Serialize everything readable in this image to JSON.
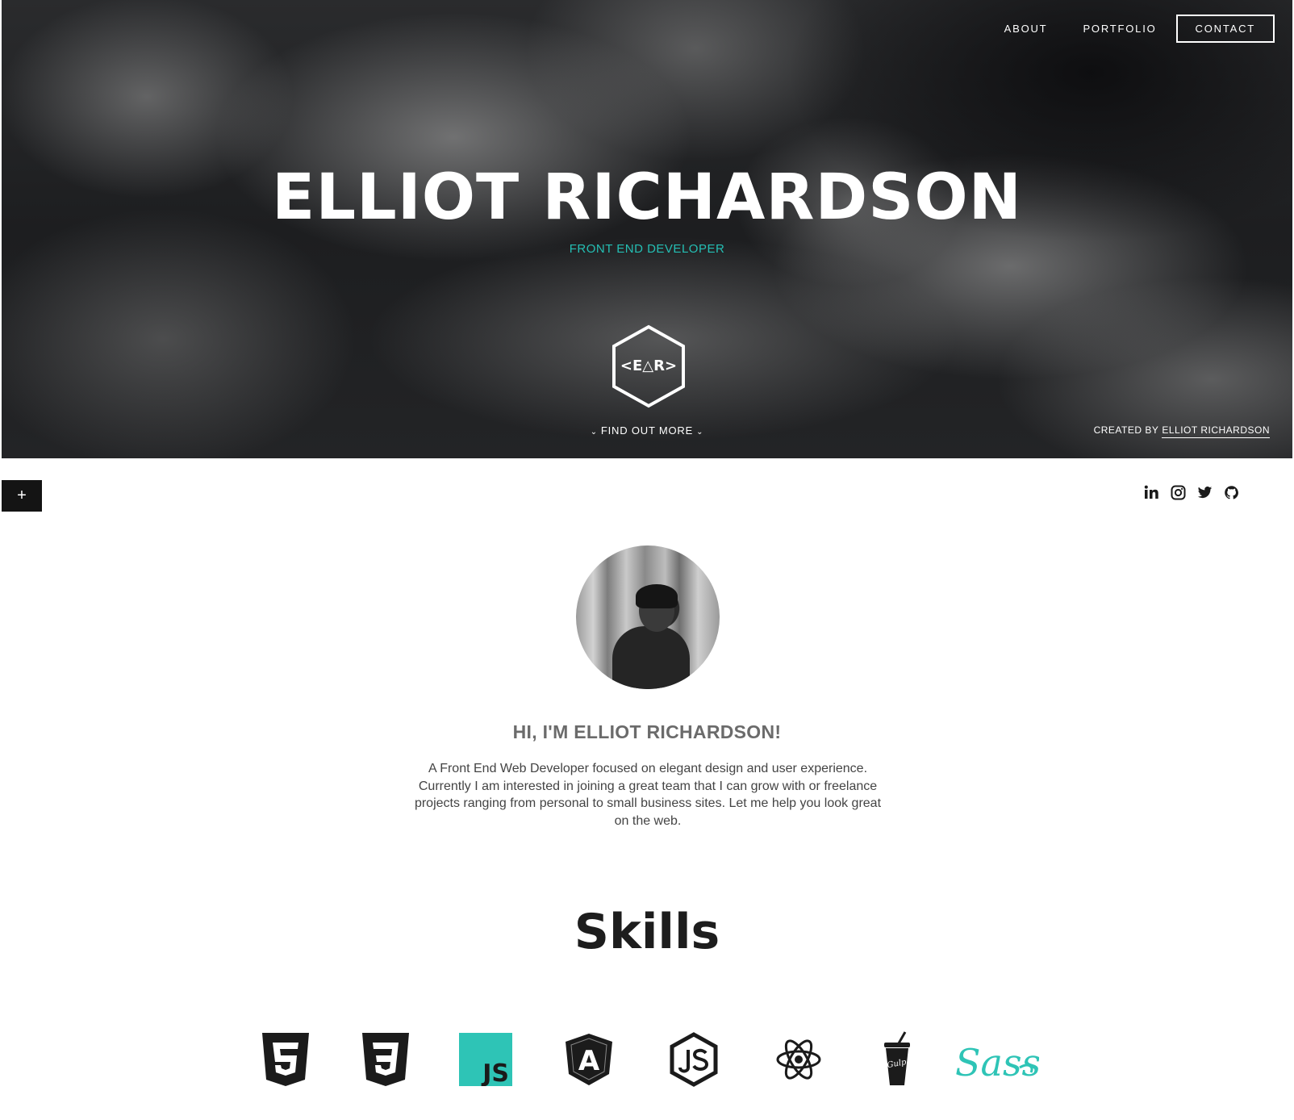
{
  "nav": {
    "about": "ABOUT",
    "portfolio": "PORTFOLIO",
    "contact": "CONTACT"
  },
  "hero": {
    "title": "ELLIOT RICHARDSON",
    "subtitle": "FRONT END DEVELOPER",
    "logo_text": "<E△R>",
    "find_more": "FIND OUT MORE",
    "created_by_prefix": "CREATED BY",
    "created_by_name": "ELLIOT RICHARDSON"
  },
  "toolbar": {
    "plus": "+"
  },
  "social": [
    "linkedin-icon",
    "instagram-icon",
    "twitter-icon",
    "github-icon"
  ],
  "about": {
    "heading": "HI, I'M ELLIOT RICHARDSON!",
    "text": "A Front End Web Developer focused on elegant design and user experience. Currently I am interested in joining a great team that I can grow with or freelance projects ranging from personal to small business sites. Let me help you look great on the web."
  },
  "skills": {
    "heading": "Skills",
    "items": [
      "html5-icon",
      "css3-icon",
      "javascript-icon",
      "angular-icon",
      "nodejs-icon",
      "react-icon",
      "gulp-icon",
      "sass-icon"
    ],
    "js_label": "JS",
    "angular_label": "A",
    "gulp_label": "Gulp",
    "sass_label": "Sass"
  },
  "colors": {
    "accent": "#24bfb4",
    "dark": "#141414",
    "text": "#444444"
  }
}
